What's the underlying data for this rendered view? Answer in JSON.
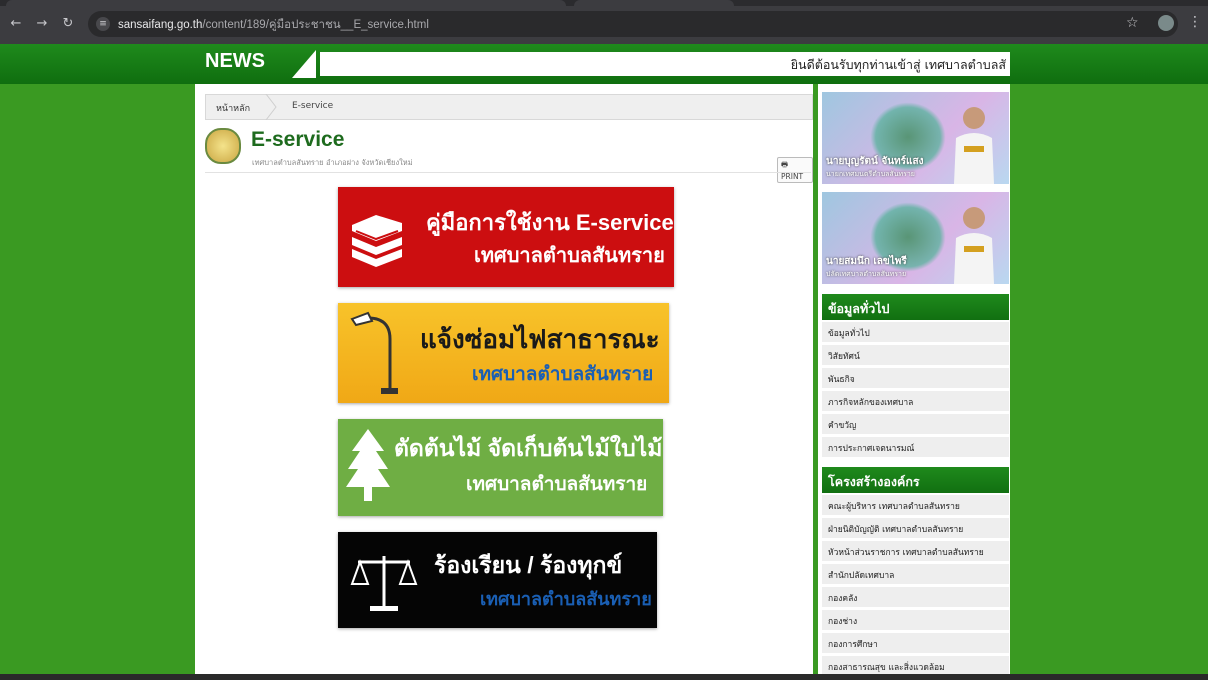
{
  "browser": {
    "url_domain": "sansaifang.go.th",
    "url_path": "/content/189/คู่มือประชาชน__E_service.html"
  },
  "newsbar": {
    "label": "NEWS",
    "ticker": "ยินดีต้อนรับทุกท่านเข้าสู่ เทศบาลตำบลสั"
  },
  "breadcrumb": {
    "home": "หน้าหลัก",
    "current": "E-service"
  },
  "page": {
    "title": "E-service",
    "subtitle": "เทศบาลตำบลสันทราย อำเภอฝาง จังหวัดเชียงใหม่",
    "print": "PRINT"
  },
  "banners": [
    {
      "line1": "คู่มือการใช้งาน E-service",
      "line2": "เทศบาลตำบลสันทราย"
    },
    {
      "line1": "แจ้งซ่อมไฟสาธารณะ",
      "line2": "เทศบาลตำบลสันทราย"
    },
    {
      "line1": "ตัดต้นไม้ จัดเก็บต้นไม้ใบไม้",
      "line2": "เทศบาลตำบลสันทราย"
    },
    {
      "line1": "ร้องเรียน / ร้องทุกข์",
      "line2": "เทศบาลตำบลสันทราย"
    }
  ],
  "sidebar": {
    "profiles": [
      {
        "name": "นายบุญรัตน์  จันทร์แสง",
        "role": "นายกเทศมนตรีตำบลสันทราย"
      },
      {
        "name": "นายสมนึก  เลขไพรี",
        "role": "ปลัดเทศบาลตำบลสันทราย"
      }
    ],
    "section1": {
      "title": "ข้อมูลทั่วไป",
      "items": [
        "ข้อมูลทั่วไป",
        "วิสัยทัศน์",
        "พันธกิจ",
        "ภารกิจหลักของเทศบาล",
        "คำขวัญ",
        "การประกาศเจตนารมณ์"
      ]
    },
    "section2": {
      "title": "โครงสร้างองค์กร",
      "items": [
        "คณะผู้บริหาร เทศบาลตำบลสันทราย",
        "ฝ่ายนิติบัญญัติ เทศบาลตำบลสันทราย",
        "หัวหน้าส่วนราชการ เทศบาลตำบลสันทราย",
        "สำนักปลัดเทศบาล",
        "กองคลัง",
        "กองช่าง",
        "กองการศึกษา",
        "กองสาธารณสุข และสิ่งแวดล้อม"
      ]
    }
  },
  "colors": {
    "brand_green": "#1f8a1c",
    "page_bg": "#3a9a22",
    "banner_red": "#cc0e10",
    "banner_yellow": "#f8c32a",
    "banner_green": "#6fae44",
    "banner_black": "#050505",
    "banner_blue_text": "#1a5fb4"
  }
}
